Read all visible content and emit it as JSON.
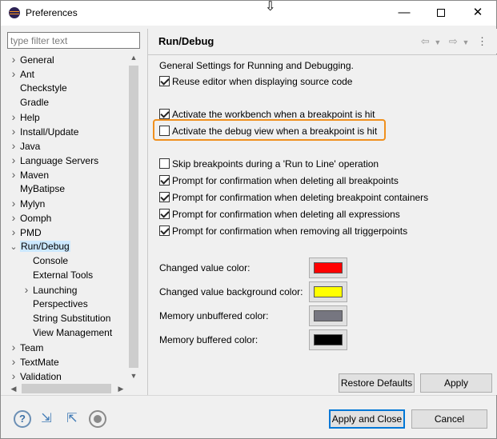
{
  "window": {
    "title": "Preferences",
    "minimize_glyph": "—",
    "close_glyph": "✕"
  },
  "filter": {
    "placeholder": "type filter text",
    "value": ""
  },
  "tree": {
    "items": [
      {
        "label": "General",
        "expandable": true
      },
      {
        "label": "Ant",
        "expandable": true
      },
      {
        "label": "Checkstyle",
        "expandable": false
      },
      {
        "label": "Gradle",
        "expandable": false
      },
      {
        "label": "Help",
        "expandable": true
      },
      {
        "label": "Install/Update",
        "expandable": true
      },
      {
        "label": "Java",
        "expandable": true
      },
      {
        "label": "Language Servers",
        "expandable": true
      },
      {
        "label": "Maven",
        "expandable": true
      },
      {
        "label": "MyBatipse",
        "expandable": false
      },
      {
        "label": "Mylyn",
        "expandable": true
      },
      {
        "label": "Oomph",
        "expandable": true
      },
      {
        "label": "PMD",
        "expandable": true
      },
      {
        "label": "Run/Debug",
        "expandable": true,
        "expanded": true,
        "selected": true
      },
      {
        "label": "Console",
        "expandable": false
      },
      {
        "label": "External Tools",
        "expandable": false
      },
      {
        "label": "Launching",
        "expandable": true
      },
      {
        "label": "Perspectives",
        "expandable": false
      },
      {
        "label": "String Substitution",
        "expandable": false
      },
      {
        "label": "View Management",
        "expandable": false
      },
      {
        "label": "Team",
        "expandable": true
      },
      {
        "label": "TextMate",
        "expandable": true
      },
      {
        "label": "Validation",
        "expandable": true
      }
    ]
  },
  "page": {
    "title": "Run/Debug",
    "description": "General Settings for Running and Debugging.",
    "checkboxes": [
      {
        "label": "Reuse editor when displaying source code",
        "checked": true
      },
      {
        "label": "Activate the workbench when a breakpoint is hit",
        "checked": true
      },
      {
        "label": "Activate the debug view when a breakpoint is hit",
        "checked": false,
        "highlighted": true
      },
      {
        "label": "Skip breakpoints during a 'Run to Line' operation",
        "checked": false
      },
      {
        "label": "Prompt for confirmation when deleting all breakpoints",
        "checked": true
      },
      {
        "label": "Prompt for confirmation when deleting breakpoint containers",
        "checked": true
      },
      {
        "label": "Prompt for confirmation when deleting all expressions",
        "checked": true
      },
      {
        "label": "Prompt for confirmation when removing all triggerpoints",
        "checked": true
      }
    ],
    "colors": [
      {
        "label": "Changed value color:",
        "color": "#ff0000"
      },
      {
        "label": "Changed value background color:",
        "color": "#ffff00"
      },
      {
        "label": "Memory unbuffered color:",
        "color": "#767680"
      },
      {
        "label": "Memory buffered color:",
        "color": "#000000"
      }
    ]
  },
  "buttons": {
    "restore_defaults": "Restore Defaults",
    "apply": "Apply",
    "apply_and_close": "Apply and Close",
    "cancel": "Cancel"
  },
  "icons": {
    "back": "arrow-left-icon",
    "forward": "arrow-right-icon",
    "menu": "kebab-menu-icon",
    "help": "help-icon",
    "import": "import-icon",
    "export": "export-icon",
    "record": "record-icon"
  },
  "accent_color": "#f0901e",
  "selection_color": "#cce8ff"
}
